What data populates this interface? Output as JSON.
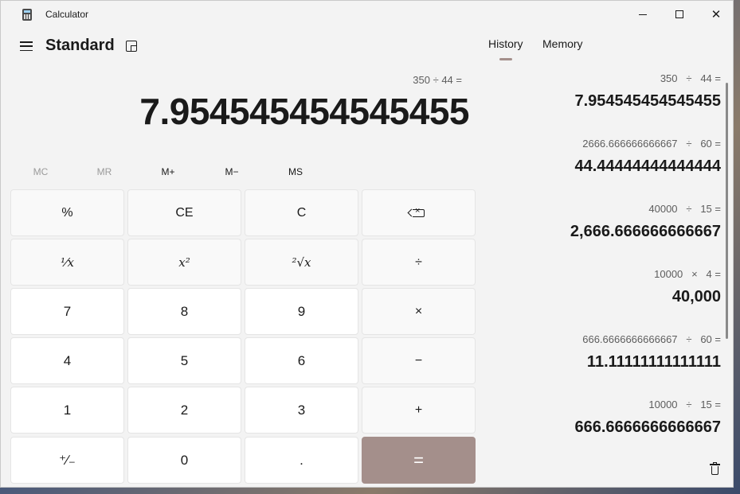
{
  "app": {
    "title": "Calculator"
  },
  "header": {
    "mode": "Standard"
  },
  "display": {
    "expression": "350 ÷ 44 =",
    "value": "7.954545454545455"
  },
  "memory_buttons": [
    "MC",
    "MR",
    "M+",
    "M−",
    "MS"
  ],
  "keys": {
    "percent": "%",
    "ce": "CE",
    "c": "C",
    "reciprocal": "⅟x",
    "square": "x²",
    "sqrt": "²√x",
    "divide": "÷",
    "seven": "7",
    "eight": "8",
    "nine": "9",
    "multiply": "×",
    "four": "4",
    "five": "5",
    "six": "6",
    "minus": "−",
    "one": "1",
    "two": "2",
    "three": "3",
    "plus": "+",
    "negate": "⁺∕₋",
    "zero": "0",
    "decimal": ".",
    "equals": "="
  },
  "tabs": {
    "history": "History",
    "memory": "Memory"
  },
  "history": [
    {
      "expression": "350   ÷   44 =",
      "result": "7.954545454545455"
    },
    {
      "expression": "2666.666666666667   ÷   60 =",
      "result": "44.44444444444444"
    },
    {
      "expression": "40000   ÷   15 =",
      "result": "2,666.666666666667"
    },
    {
      "expression": "10000   ×   4 =",
      "result": "40,000"
    },
    {
      "expression": "666.6666666666667   ÷   60 =",
      "result": "11.11111111111111"
    },
    {
      "expression": "10000   ÷   15 =",
      "result": "666.6666666666667"
    }
  ],
  "colors": {
    "accent": "#a48f8b",
    "background": "#f3f3f3"
  }
}
